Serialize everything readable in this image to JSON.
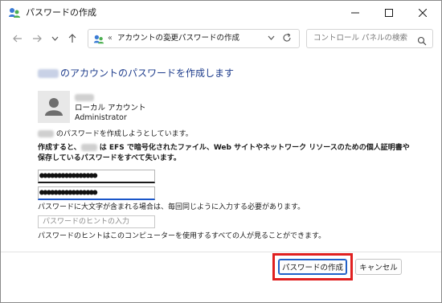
{
  "window": {
    "title": "パスワードの作成"
  },
  "nav": {
    "address_chevron": "«",
    "address_segment_1": "アカウントの変更",
    "address_separator": "›",
    "address_segment_2": "パスワードの作成",
    "search_placeholder": "コントロール パネルの検索"
  },
  "main": {
    "heading_suffix": "のアカウントのパスワードを作成します",
    "account_type": "ローカル アカウント",
    "account_group": "Administrator",
    "intro_suffix": "のパスワードを作成しようとしています。",
    "warning_prefix": "作成すると、",
    "warning_suffix": " は EFS で暗号化されたファイル、Web サイトやネットワーク リソースのための個人証明書や保存しているパスワードをすべて失います。",
    "password_value": "●●●●●●●●●●●●●●●●",
    "password_confirm_value": "●●●●●●●●●●●●●●●●",
    "case_note": "パスワードに大文字が含まれる場合は、毎回同じように入力する必要があります。",
    "hint_placeholder": "パスワードのヒントの入力",
    "hint_note": "パスワードのヒントはこのコンピューターを使用するすべての人が見ることができます。"
  },
  "footer": {
    "create_label": "パスワードの作成",
    "cancel_label": "キャンセル"
  },
  "colors": {
    "heading": "#1e3c8c",
    "accent": "#2060c8",
    "highlight": "#e02020"
  }
}
